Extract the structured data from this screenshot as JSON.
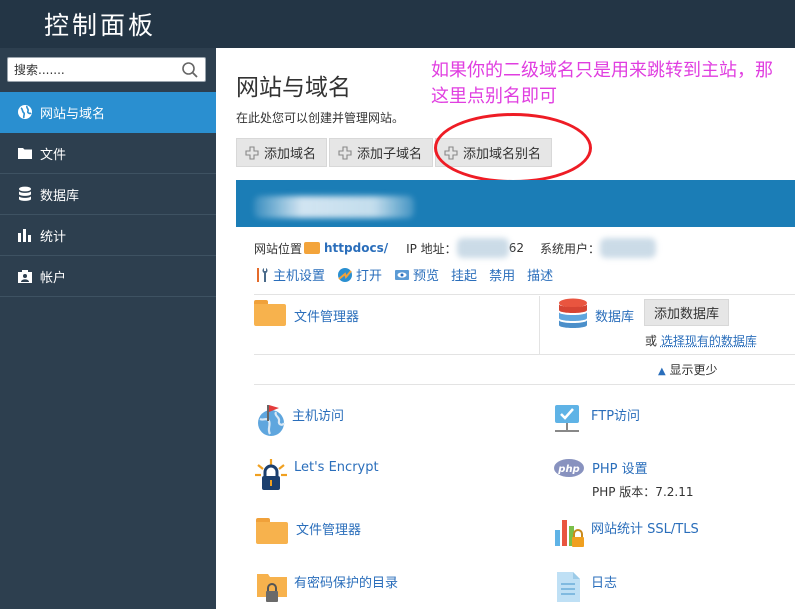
{
  "app": {
    "title": "控制面板"
  },
  "sidebar": {
    "search_placeholder": "搜索.......",
    "items": [
      {
        "label": "网站与域名",
        "icon": "globe-icon",
        "active": true
      },
      {
        "label": "文件",
        "icon": "folder-icon"
      },
      {
        "label": "数据库",
        "icon": "database-icon"
      },
      {
        "label": "统计",
        "icon": "bar-chart-icon"
      },
      {
        "label": "帐户",
        "icon": "account-icon"
      }
    ]
  },
  "main": {
    "title": "网站与域名",
    "description": "在此处您可以创建并管理网站。",
    "annotation": "如果你的二级域名只是用来跳转到主站，那这里点别名即可",
    "annotation_color": "#e03ee0",
    "buttons": [
      "添加域名",
      "添加子域名",
      "添加域名别名"
    ]
  },
  "site": {
    "location_label": "网站位置",
    "location_value": "httpdocs/",
    "ip_label": "IP 地址：",
    "ip_value_visible": "62",
    "sysuser_label": "系统用户：",
    "actions": [
      "主机设置",
      "打开",
      "预览",
      "挂起",
      "禁用",
      "描述"
    ]
  },
  "tools": {
    "file_manager": "文件管理器",
    "databases": "数据库",
    "add_database": "添加数据库",
    "or": "或",
    "select_existing_db": "选择现有的数据库",
    "show_less": "显示更少",
    "hosting_access": "主机访问",
    "ftp_access": "FTP访问",
    "lets_encrypt": "Let's Encrypt",
    "php_settings": "PHP 设置",
    "php_version": "PHP 版本：7.2.11",
    "file_manager2": "文件管理器",
    "web_stats": "网站统计 SSL/TLS",
    "password_dirs": "有密码保护的目录",
    "logs": "日志"
  },
  "colors": {
    "accent": "#2a8fd0",
    "topbar": "#233545",
    "sidebar": "#2d3f4f",
    "link": "#2a6ebb",
    "highlight_circle": "#ee1c25"
  }
}
